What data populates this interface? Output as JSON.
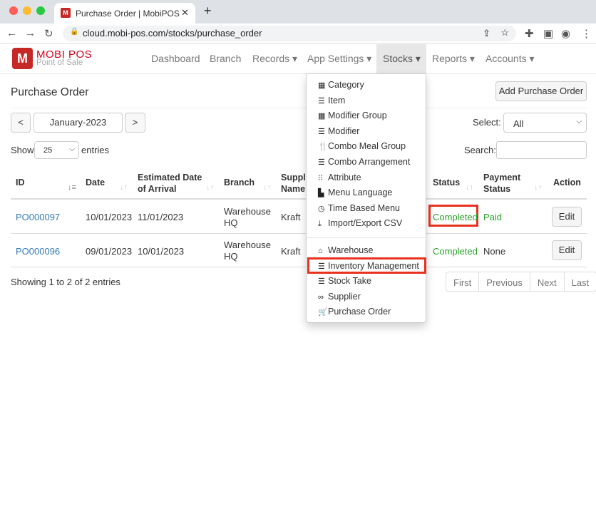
{
  "browser": {
    "tab_title": "Purchase Order | MobiPOS",
    "url": "cloud.mobi-pos.com/stocks/purchase_order"
  },
  "brand": {
    "name": "MOBI POS",
    "tagline": "Point of Sale",
    "logo_letter": "M"
  },
  "nav": [
    {
      "label": "Dashboard"
    },
    {
      "label": "Branch"
    },
    {
      "label": "Records ▾"
    },
    {
      "label": "App Settings ▾"
    },
    {
      "label": "Stocks ▾"
    },
    {
      "label": "Reports ▾"
    },
    {
      "label": "Accounts ▾"
    }
  ],
  "page": {
    "title": "Purchase Order",
    "add_button": "Add Purchase Order",
    "prev": "<",
    "next": ">",
    "month": "January-2023",
    "select_label": "Select:",
    "select_value": "All",
    "show_label": "Show",
    "page_size": "25",
    "entries_label": "entries",
    "search_label": "Search:",
    "search_value": ""
  },
  "table": {
    "headers": [
      "ID",
      "Date",
      "Estimated Date of Arrival",
      "Branch",
      "Supplier Name",
      "Status",
      "Payment Status",
      "Action"
    ],
    "rows": [
      {
        "id": "PO000097",
        "date": "10/01/2023",
        "eta": "11/01/2023",
        "branch": "Warehouse HQ",
        "supplier": "Kraft",
        "status": "Completed",
        "payment": "Paid",
        "action": "Edit"
      },
      {
        "id": "PO000096",
        "date": "09/01/2023",
        "eta": "10/01/2023",
        "branch": "Warehouse HQ",
        "supplier": "Kraft",
        "status": "Completed",
        "payment": "None",
        "action": "Edit"
      }
    ]
  },
  "footer": {
    "info": "Showing 1 to 2 of 2 entries",
    "pager": [
      "First",
      "Previous",
      "Next",
      "Last"
    ]
  },
  "stocks_menu": [
    {
      "label": "Category",
      "icon": "th-large-icon",
      "glyph": "▦"
    },
    {
      "label": "Item",
      "icon": "list-icon",
      "glyph": "☰"
    },
    {
      "label": "Modifier Group",
      "icon": "th-large-icon",
      "glyph": "▦"
    },
    {
      "label": "Modifier",
      "icon": "list-icon",
      "glyph": "☰"
    },
    {
      "label": "Combo Meal Group",
      "icon": "cutlery-icon",
      "glyph": "🍴"
    },
    {
      "label": "Combo Arrangement",
      "icon": "list-icon",
      "glyph": "☰"
    },
    {
      "label": "Attribute",
      "icon": "th-icon",
      "glyph": "⁝⁝"
    },
    {
      "label": "Menu Language",
      "icon": "file-icon",
      "glyph": "▙"
    },
    {
      "label": "Time Based Menu",
      "icon": "clock-icon",
      "glyph": "◷"
    },
    {
      "label": "Import/Export CSV",
      "icon": "import-icon",
      "glyph": "⤓"
    },
    {
      "label": "Warehouse",
      "icon": "home-icon",
      "glyph": "⌂"
    },
    {
      "label": "Inventory Management",
      "icon": "tasks-icon",
      "glyph": "☰"
    },
    {
      "label": "Stock Take",
      "icon": "list-icon",
      "glyph": "☰"
    },
    {
      "label": "Supplier",
      "icon": "link-icon",
      "glyph": "∞"
    },
    {
      "label": "Purchase Order",
      "icon": "cart-icon",
      "glyph": "🛒"
    }
  ],
  "colors": {
    "brand": "#d0021b",
    "link": "#337ab7",
    "success": "#2ca02c",
    "highlight": "#e8321d"
  }
}
